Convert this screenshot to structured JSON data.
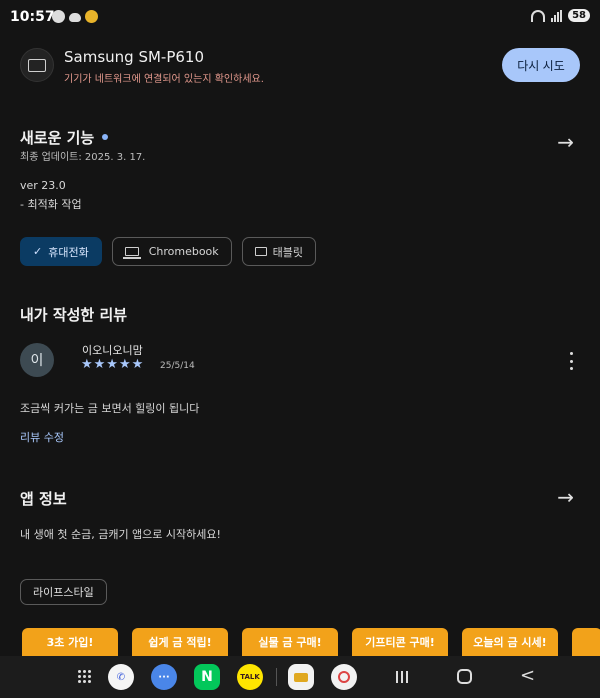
{
  "status_bar": {
    "time": "10:57",
    "battery": "58"
  },
  "device": {
    "name": "Samsung SM-P610",
    "message": "기기가 네트워크에 연결되어 있는지 확인하세요.",
    "retry_label": "다시 시도"
  },
  "whats_new": {
    "title": "새로운 기능",
    "updated": "최종 업데이트: 2025. 3. 17.",
    "version": "ver 23.0",
    "note": "- 최적화 작업"
  },
  "device_chips": [
    {
      "label": "휴대전화",
      "selected": true,
      "icon": "check-icon"
    },
    {
      "label": "Chromebook",
      "selected": false,
      "icon": "laptop-icon"
    },
    {
      "label": "태블릿",
      "selected": false,
      "icon": "tablet-icon"
    }
  ],
  "my_review": {
    "title": "내가 작성한 리뷰",
    "avatar_letter": "이",
    "reviewer": "이오니오니맘",
    "stars": "★★★★★",
    "rating": 5,
    "date": "25/5/14",
    "text": "조금씩 커가는 금 보면서 힐링이 됩니다",
    "edit_label": "리뷰 수정"
  },
  "app_info": {
    "title": "앱 정보",
    "description": "내 생애 첫 순금, 금캐기 앱으로 시작하세요!",
    "category": "라이프스타일"
  },
  "screenshots": [
    {
      "label": "3초 가입!"
    },
    {
      "label": "쉽게 금 적립!"
    },
    {
      "label": "실물 금 구매!"
    },
    {
      "label": "기프티콘 구매!"
    },
    {
      "label": "오늘의 금 시세!"
    },
    {
      "label": ""
    }
  ],
  "nav_apps": [
    {
      "name": "phone-app-icon",
      "label": "",
      "color": "#f5f5f5"
    },
    {
      "name": "messages-app-icon",
      "label": "",
      "color": "#4a86e8"
    },
    {
      "name": "naver-app-icon",
      "label": "N",
      "color": "#03c75a"
    },
    {
      "name": "kakaotalk-app-icon",
      "label": "TALK",
      "color": "#fee500"
    },
    {
      "name": "gold-app-icon",
      "label": "",
      "color": "#f2f2f2"
    },
    {
      "name": "shield-app-icon",
      "label": "",
      "color": "#f2f2f2"
    }
  ],
  "colors": {
    "background": "#141414",
    "accent": "#a8c7fa",
    "error_text": "#e59a8e",
    "selected_chip": "#0b3b63",
    "banner": "#f2a21a"
  }
}
